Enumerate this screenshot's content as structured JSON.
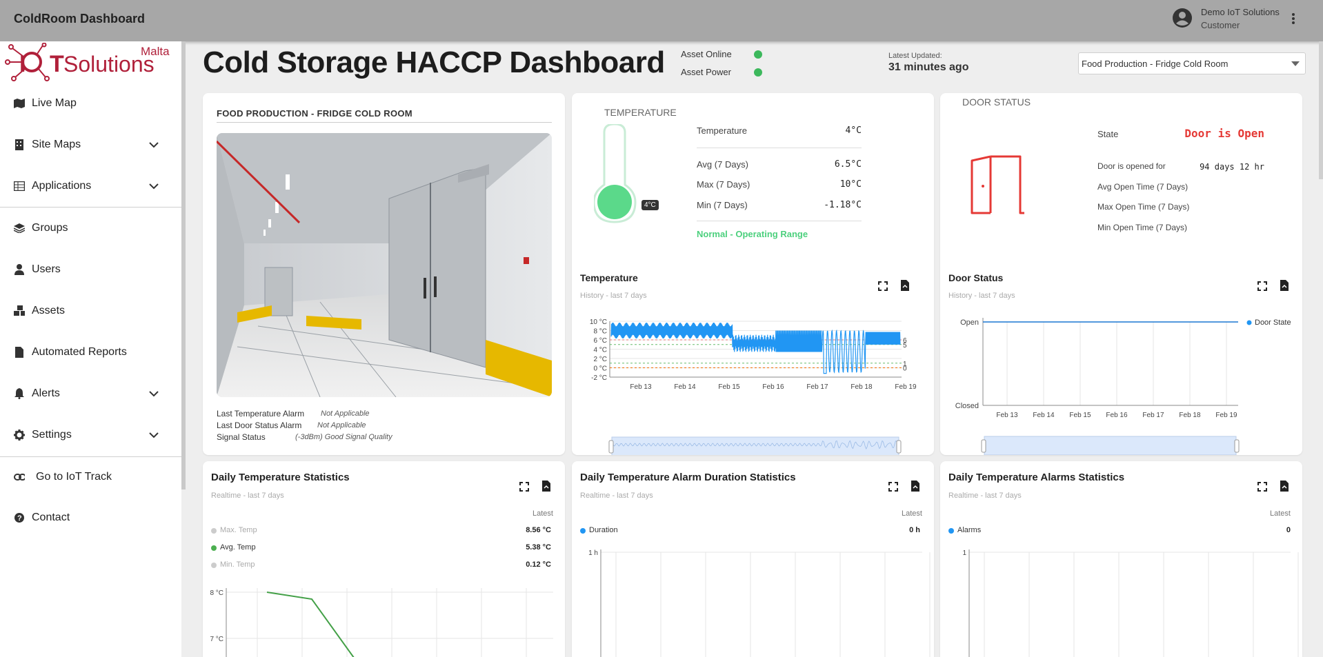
{
  "app": {
    "title": "ColdRoom Dashboard"
  },
  "user": {
    "name": "Demo IoT Solutions",
    "role": "Customer"
  },
  "logo": {
    "top_text": "Malta",
    "brand_i": "I",
    "brand_o": "O",
    "brand_t": "T",
    "brand_rest": "Solutions"
  },
  "sidebar": {
    "items": [
      {
        "label": "Live Map"
      },
      {
        "label": "Site Maps"
      },
      {
        "label": "Applications"
      },
      {
        "label": "Groups"
      },
      {
        "label": "Users"
      },
      {
        "label": "Assets"
      },
      {
        "label": "Automated Reports"
      },
      {
        "label": "Alerts"
      },
      {
        "label": "Settings"
      },
      {
        "label": "Go to IoT Track"
      },
      {
        "label": "Contact"
      }
    ]
  },
  "header": {
    "title": "Cold Storage HACCP Dashboard",
    "asset_online": "Asset Online",
    "asset_power": "Asset Power",
    "status_color": "#3cb85c",
    "latest_updated_label": "Latest Updated:",
    "latest_updated_value": "31 minutes ago",
    "asset_select": "Food Production - Fridge Cold Room"
  },
  "room_card": {
    "title": "FOOD PRODUCTION - FRIDGE COLD ROOM",
    "last_temp_alarm_label": "Last Temperature Alarm",
    "last_temp_alarm_value": "Not Applicable",
    "last_door_alarm_label": "Last Door Status Alarm",
    "last_door_alarm_value": "Not Applicable",
    "signal_label": "Signal Status",
    "signal_value": "(-3dBm) Good Signal Quality"
  },
  "temperature_card": {
    "title": "TEMPERATURE",
    "badge": "4°C",
    "current_label": "Temperature",
    "current_value": "4°C",
    "avg_label": "Avg (7 Days)",
    "avg_value": "6.5°C",
    "max_label": "Max (7 Days)",
    "max_value": "10°C",
    "min_label": "Min (7 Days)",
    "min_value": "-1.18°C",
    "status": "Normal - Operating Range",
    "status_color": "#4cd07d",
    "chart_title": "Temperature",
    "chart_subtitle": "History - last 7 days"
  },
  "door_card": {
    "title": "DOOR STATUS",
    "state_label": "State",
    "state_value": "Door is Open",
    "state_color": "#e53935",
    "opened_for_label": "Door is opened for",
    "opened_for_value": "94 days 12 hr",
    "avg_open_label": "Avg Open Time (7 Days)",
    "max_open_label": "Max Open Time (7 Days)",
    "min_open_label": "Min Open Time (7 Days)",
    "chart_title": "Door Status",
    "chart_subtitle": "History - last 7 days",
    "legend": "Door State"
  },
  "daily_temp": {
    "title": "Daily Temperature Statistics",
    "subtitle": "Realtime - last 7 days",
    "latest": "Latest",
    "rows": [
      {
        "name": "Max. Temp",
        "value": "8.56 °C"
      },
      {
        "name": "Avg. Temp",
        "value": "5.38 °C"
      },
      {
        "name": "Min. Temp",
        "value": "0.12 °C"
      }
    ],
    "y_ticks": [
      "8 °C",
      "7 °C"
    ]
  },
  "alarm_duration": {
    "title": "Daily Temperature Alarm Duration Statistics",
    "subtitle": "Realtime - last 7 days",
    "latest": "Latest",
    "row_name": "Duration",
    "row_value": "0 h",
    "y_tick": "1 h"
  },
  "alarms_stats": {
    "title": "Daily Temperature Alarms Statistics",
    "subtitle": "Realtime - last 7 days",
    "latest": "Latest",
    "row_name": "Alarms",
    "row_value": "0",
    "y_tick": "1"
  },
  "chart_data": [
    {
      "type": "line",
      "title": "Temperature",
      "subtitle": "History - last 7 days",
      "x": [
        "Feb 13",
        "Feb 14",
        "Feb 15",
        "Feb 16",
        "Feb 17",
        "Feb 18",
        "Feb 19"
      ],
      "ylim": [
        -2,
        10
      ],
      "y_ticks": [
        "10 °C",
        "8 °C",
        "6 °C",
        "4 °C",
        "2 °C",
        "0 °C",
        "-2 °C"
      ],
      "threshold_labels": [
        "6",
        "5",
        "1",
        "0"
      ],
      "grid": true
    },
    {
      "type": "line",
      "title": "Door Status",
      "subtitle": "History - last 7 days",
      "x": [
        "Feb 13",
        "Feb 14",
        "Feb 15",
        "Feb 16",
        "Feb 17",
        "Feb 18",
        "Feb 19"
      ],
      "y_categories": [
        "Open",
        "Closed"
      ],
      "series": [
        {
          "name": "Door State",
          "values": [
            "Open",
            "Open",
            "Open",
            "Open",
            "Open",
            "Open",
            "Open"
          ]
        }
      ],
      "legend": "top-right",
      "grid": true
    },
    {
      "type": "line",
      "title": "Daily Temperature Statistics",
      "y_ticks": [
        "8 °C",
        "7 °C"
      ],
      "series": [
        {
          "name": "Avg. Temp",
          "values": [
            8.0,
            7.85,
            6.5
          ]
        }
      ]
    }
  ]
}
